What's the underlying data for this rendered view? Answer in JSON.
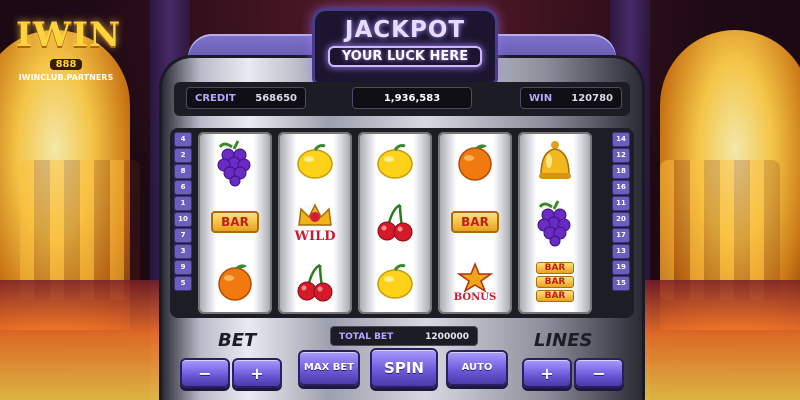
{
  "brand": {
    "logo_text": "IWIN",
    "logo_number": "888",
    "logo_domain": "IWINCLUB.PARTNERS"
  },
  "jackpot": {
    "title": "JACKPOT",
    "subtitle": "YOUR LUCK HERE"
  },
  "info": {
    "credit_label": "CREDIT",
    "credit_value": "568650",
    "center_value": "1,936,583",
    "win_label": "WIN",
    "win_value": "120780"
  },
  "lines_left": [
    "4",
    "2",
    "8",
    "6",
    "1",
    "10",
    "7",
    "3",
    "9",
    "5"
  ],
  "lines_right": [
    "14",
    "12",
    "18",
    "16",
    "11",
    "20",
    "17",
    "13",
    "19",
    "15"
  ],
  "reels": [
    [
      "grapes-icon",
      "bar-icon",
      "orange-icon"
    ],
    [
      "lemon-icon",
      "wild-icon",
      "cherries-icon"
    ],
    [
      "lemon-icon",
      "cherries-icon",
      "lemon-icon"
    ],
    [
      "orange-icon",
      "bar-icon",
      "bonus-icon"
    ],
    [
      "bell-icon",
      "grapes-icon",
      "triple-bar-icon"
    ]
  ],
  "symbols": {
    "bar": "BAR",
    "wild": "WILD",
    "bonus": "BONUS"
  },
  "controls": {
    "bet_label": "BET",
    "lines_label": "LINES",
    "total_bet_label": "TOTAL BET",
    "total_bet_value": "1200000",
    "minus": "−",
    "plus": "+",
    "max_bet": "MAX BET",
    "spin": "SPIN",
    "auto": "AUTO"
  },
  "colors": {
    "accent": "#7b68e6",
    "gold": "#ffd43a"
  }
}
